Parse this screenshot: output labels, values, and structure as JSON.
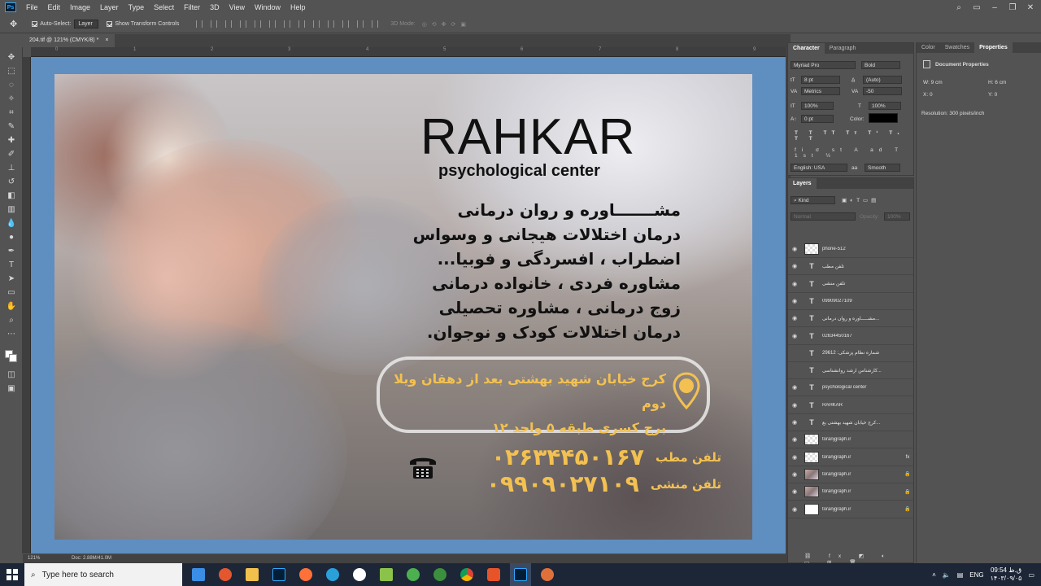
{
  "menu": {
    "logo": "Ps",
    "items": [
      "File",
      "Edit",
      "Image",
      "Layer",
      "Type",
      "Select",
      "Filter",
      "3D",
      "View",
      "Window",
      "Help"
    ]
  },
  "options": {
    "auto_select_label": "Auto-Select:",
    "auto_select_value": "Layer",
    "transform_label": "Show Transform Controls",
    "mode_3d": "3D Mode:"
  },
  "document": {
    "tab_title": "204.tif @ 121% (CMYK/8) *",
    "close_glyph": "×",
    "ruler_marks": [
      "0",
      "1",
      "2",
      "3",
      "4",
      "5",
      "6",
      "7",
      "8",
      "9"
    ]
  },
  "artwork": {
    "brand_title": "RAHKAR",
    "brand_subtitle": "psychological center",
    "service_lines": [
      "مشـــــــاوره و روان درمانی",
      "درمان اختلالات هیجانی و وسواس",
      "اضطراب ، افسردگی و فوبیا...",
      "مشاوره فردی ، خانواده درمانی",
      "زوج درمانی ، مشاوره تحصیلی",
      "درمان اختلالات کودک و نوجوان."
    ],
    "address_line1": "کرج خیابان شهید بهشتی بعد از دهقان ویلا دوم",
    "address_line2": "برج کسری طبقه ۵ واحد ۱۲",
    "office_phone_label": "تلفن مطب",
    "office_phone": "۰۲۶۳۴۴۵۰۱۶۷",
    "secretary_phone_label": "تلفن منشی",
    "secretary_phone": "۰۹۹۰۹۰۲۷۱۰۹",
    "accent_color": "#f3c151"
  },
  "character_panel": {
    "tabs": [
      "Character",
      "Paragraph"
    ],
    "font_family": "Myriad Pro",
    "font_style": "Bold",
    "font_size": "8 pt",
    "leading": "(Auto)",
    "kerning": "Metrics",
    "tracking": "-50",
    "vscale": "100%",
    "hscale": "100%",
    "baseline": "0 pt",
    "color_label": "Color:",
    "language": "English: USA",
    "antialias": "Smooth"
  },
  "properties_panel": {
    "tabs": [
      "Color",
      "Swatches",
      "Properties"
    ],
    "title": "Document Properties",
    "w": "W:  9 cm",
    "h": "H:  6 cm",
    "x": "X:  0",
    "y": "Y:  0",
    "resolution": "Resolution: 300 pixels/inch"
  },
  "layers_panel": {
    "title": "Layers",
    "filter_kind": "Kind",
    "blend_mode": "Normal",
    "opacity_label": "Opacity:",
    "opacity_value": "100%",
    "layers": [
      {
        "name": "phone-512",
        "thumb": "checker",
        "visible": true,
        "extra": ""
      },
      {
        "name": "تلفن مطب",
        "thumb": "T",
        "visible": true,
        "extra": ""
      },
      {
        "name": "تلفن منشی",
        "thumb": "T",
        "visible": true,
        "extra": ""
      },
      {
        "name": "09909027109",
        "thumb": "T",
        "visible": true,
        "extra": ""
      },
      {
        "name": "مشـــــاوره و روان درمانی...",
        "thumb": "T",
        "visible": true,
        "extra": ""
      },
      {
        "name": "02634450167",
        "thumb": "T",
        "visible": true,
        "extra": ""
      },
      {
        "name": "شماره نظام پزشکی: 29612",
        "thumb": "T",
        "visible": false,
        "extra": ""
      },
      {
        "name": "کارشناس ارشد روانشناسی...",
        "thumb": "T",
        "visible": false,
        "extra": ""
      },
      {
        "name": "psychological center",
        "thumb": "T",
        "visible": true,
        "extra": ""
      },
      {
        "name": "RAHKAR",
        "thumb": "T",
        "visible": true,
        "extra": ""
      },
      {
        "name": "کرج خیابان شهید بهشتی بع...",
        "thumb": "T",
        "visible": true,
        "extra": ""
      },
      {
        "name": "toranjgraph.ir",
        "thumb": "checker",
        "visible": true,
        "extra": ""
      },
      {
        "name": "toranjgraph.ir",
        "thumb": "checker",
        "visible": true,
        "extra": "fx"
      },
      {
        "name": "toranjgraph.ir",
        "thumb": "img",
        "visible": true,
        "extra": "🔒"
      },
      {
        "name": "toranjgraph.ir",
        "thumb": "img",
        "visible": true,
        "extra": "🔒"
      },
      {
        "name": "toranjgraph.ir",
        "thumb": "white",
        "visible": true,
        "extra": "🔒"
      }
    ]
  },
  "status": {
    "zoom": "121%",
    "doc_size": "Doc: 2.88M/41.0M"
  },
  "taskbar": {
    "search_placeholder": "Type here to search",
    "language": "ENG",
    "time": "09:54 ق.ظ",
    "date": "۱۴۰۳/۰۹/۰۵"
  }
}
